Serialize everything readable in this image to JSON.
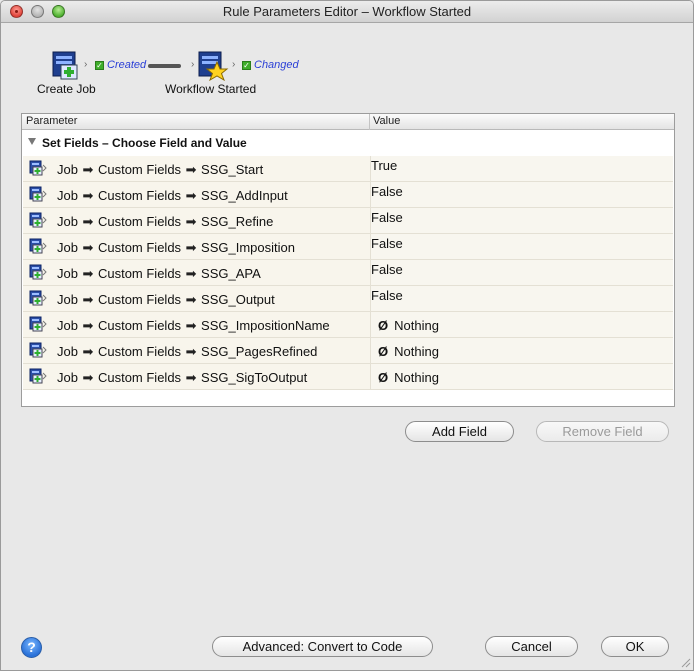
{
  "window": {
    "title": "Rule Parameters Editor – Workflow Started"
  },
  "flow": {
    "source": {
      "label": "Create Job",
      "event": "Created"
    },
    "target": {
      "label": "Workflow Started",
      "event": "Changed"
    }
  },
  "table": {
    "headers": {
      "parameter": "Parameter",
      "value": "Value"
    },
    "group_label": "Set Fields – Choose Field and Value",
    "rows": [
      {
        "seg1": "Job",
        "seg2": "Custom Fields",
        "field": "SSG_Start",
        "value": "True"
      },
      {
        "seg1": "Job",
        "seg2": "Custom Fields",
        "field": "SSG_AddInput",
        "value": "False"
      },
      {
        "seg1": "Job",
        "seg2": "Custom Fields",
        "field": "SSG_Refine",
        "value": "False"
      },
      {
        "seg1": "Job",
        "seg2": "Custom Fields",
        "field": "SSG_Imposition",
        "value": "False"
      },
      {
        "seg1": "Job",
        "seg2": "Custom Fields",
        "field": "SSG_APA",
        "value": "False"
      },
      {
        "seg1": "Job",
        "seg2": "Custom Fields",
        "field": "SSG_Output",
        "value": "False"
      },
      {
        "seg1": "Job",
        "seg2": "Custom Fields",
        "field": "SSG_ImpositionName",
        "value": "Nothing",
        "nothing_glyph": "Ø"
      },
      {
        "seg1": "Job",
        "seg2": "Custom Fields",
        "field": "SSG_PagesRefined",
        "value": "Nothing",
        "nothing_glyph": "Ø"
      },
      {
        "seg1": "Job",
        "seg2": "Custom Fields",
        "field": "SSG_SigToOutput",
        "value": "Nothing",
        "nothing_glyph": "Ø"
      }
    ]
  },
  "buttons": {
    "add_field": "Add Field",
    "remove_field": "Remove Field",
    "advanced": "Advanced: Convert to Code",
    "cancel": "Cancel",
    "ok": "OK",
    "help": "?"
  },
  "icons": {
    "job": "job-icon",
    "workflow": "workflow-star-icon",
    "row_field": "field-set-icon",
    "arrow": "right-arrow-icon"
  }
}
